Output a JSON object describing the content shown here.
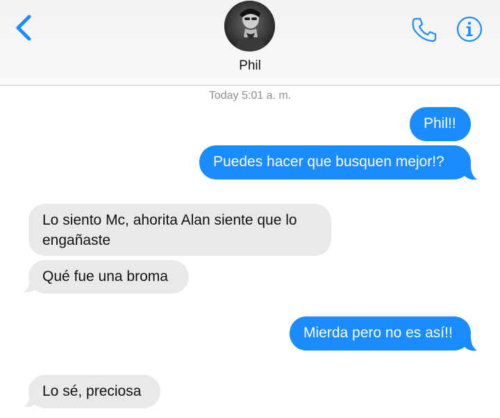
{
  "header": {
    "contact_name": "Phil",
    "back_icon": "chevron-left-icon",
    "phone_icon": "phone-icon",
    "info_icon": "info-icon",
    "accent_color": "#1a8cff"
  },
  "conversation": {
    "timestamp": "Today 5:01 a. m.",
    "messages": [
      {
        "direction": "outgoing",
        "line1": "Phil!!"
      },
      {
        "direction": "outgoing",
        "line1": "Puedes hacer que busquen mejor!?"
      },
      {
        "direction": "incoming",
        "line1": "Lo siento Mc, ahorita Alan siente que lo",
        "line2": "engañaste"
      },
      {
        "direction": "incoming",
        "line1": "Qué fue una broma"
      },
      {
        "direction": "outgoing",
        "line1": "Mierda pero no es así!!"
      },
      {
        "direction": "incoming",
        "line1": "Lo sé, preciosa"
      }
    ]
  },
  "colors": {
    "outgoing_bubble": "#1a8cff",
    "incoming_bubble": "#e9e9eb",
    "timestamp_text": "#8e8e93"
  }
}
